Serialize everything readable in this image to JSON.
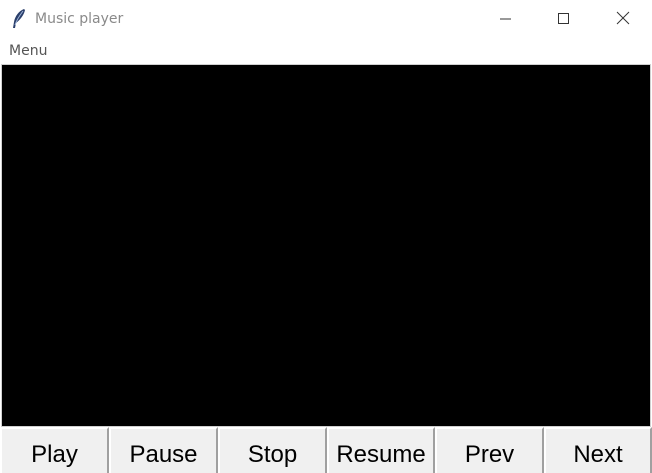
{
  "window": {
    "title": "Music player",
    "icon": "feather-icon",
    "controls": {
      "minimize_icon": "minimize-icon",
      "maximize_icon": "maximize-icon",
      "close_icon": "close-icon"
    }
  },
  "menubar": {
    "items": [
      {
        "label": "Menu"
      }
    ]
  },
  "canvas": {
    "background": "#000000"
  },
  "controls": {
    "buttons": [
      {
        "label": "Play"
      },
      {
        "label": "Pause"
      },
      {
        "label": "Stop"
      },
      {
        "label": "Resume"
      },
      {
        "label": "Prev"
      },
      {
        "label": "Next"
      }
    ]
  }
}
